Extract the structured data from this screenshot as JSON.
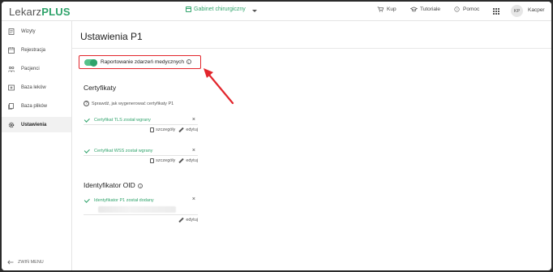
{
  "header": {
    "logo_prefix": "Lekarz",
    "logo_suffix": "PLUS",
    "clinic": "Gabinet chirurgiczny",
    "nav": [
      {
        "label": "Kup",
        "icon": "cart-icon"
      },
      {
        "label": "Tutoriale",
        "icon": "graduation-cap-icon"
      },
      {
        "label": "Pomoc",
        "icon": "help-circle-icon"
      }
    ],
    "avatar_initials": "KP",
    "user_name": "Kacper"
  },
  "sidebar": {
    "items": [
      {
        "label": "Wizyty",
        "icon": "visits-icon",
        "active": false
      },
      {
        "label": "Rejestracja",
        "icon": "registration-icon",
        "active": false
      },
      {
        "label": "Pacjenci",
        "icon": "patients-icon",
        "active": false
      },
      {
        "label": "Baza leków",
        "icon": "medicine-icon",
        "active": false
      },
      {
        "label": "Baza plików",
        "icon": "files-icon",
        "active": false
      },
      {
        "label": "Ustawienia",
        "icon": "gear-icon",
        "active": true
      }
    ],
    "collapse_label": "ZWIŃ MENU"
  },
  "main": {
    "title": "Ustawienia P1",
    "toggle": {
      "label": "Raportowanie zdarzeń medycznych",
      "on": true
    },
    "certs_section": {
      "title": "Certyfikaty",
      "help": "Sprawdź, jak wygenerować certyfikaty P1",
      "items": [
        {
          "status": "Certyfikat TLS został wgrany",
          "details": "szczegóły",
          "edit": "edytuj"
        },
        {
          "status": "Certyfikat WSS został wgrany",
          "details": "szczegóły",
          "edit": "edytuj"
        }
      ]
    },
    "oid_section": {
      "title": "Identyfikator OID",
      "status": "Identyfikator P1 został dodany",
      "edit": "edytuj"
    }
  },
  "colors": {
    "accent": "#2fa36b",
    "highlight": "#e2262c"
  }
}
